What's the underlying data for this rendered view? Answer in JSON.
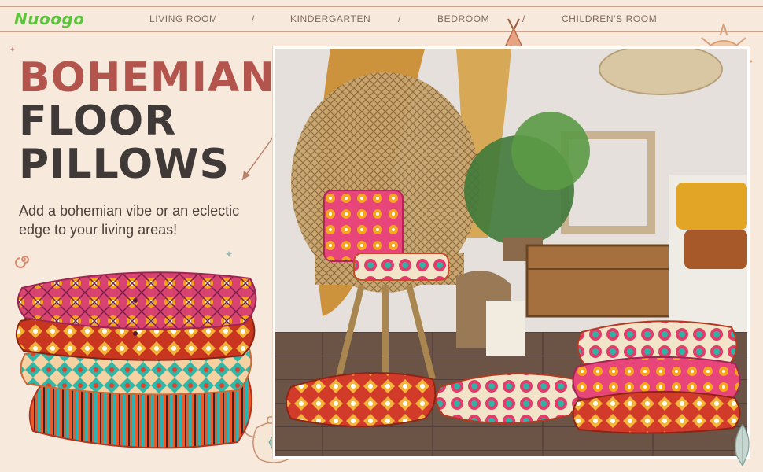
{
  "brand": {
    "name": "Nuoogo"
  },
  "nav": {
    "items": [
      {
        "label": "LIVING ROOM"
      },
      {
        "label": "KINDERGARTEN"
      },
      {
        "label": "BEDROOM"
      },
      {
        "label": "CHILDREN'S ROOM"
      }
    ],
    "separator": "/"
  },
  "hero": {
    "line1": "BOHEMIAN",
    "line2": "FLOOR",
    "line3": "PILLOWS",
    "subtitle": "Add a bohemian vibe or an eclectic edge to your living areas!"
  },
  "colors": {
    "background": "#f7e9dc",
    "brand": "#5bc43a",
    "accent_red": "#b3544d",
    "dark_text": "#3f3a37",
    "nav_text": "#7e6a5e"
  },
  "icons": [
    "teepee-icon",
    "sun-icon",
    "arrow-icon",
    "teapot-icon",
    "feather-icon",
    "sparkle-icon",
    "swirl-icon"
  ]
}
